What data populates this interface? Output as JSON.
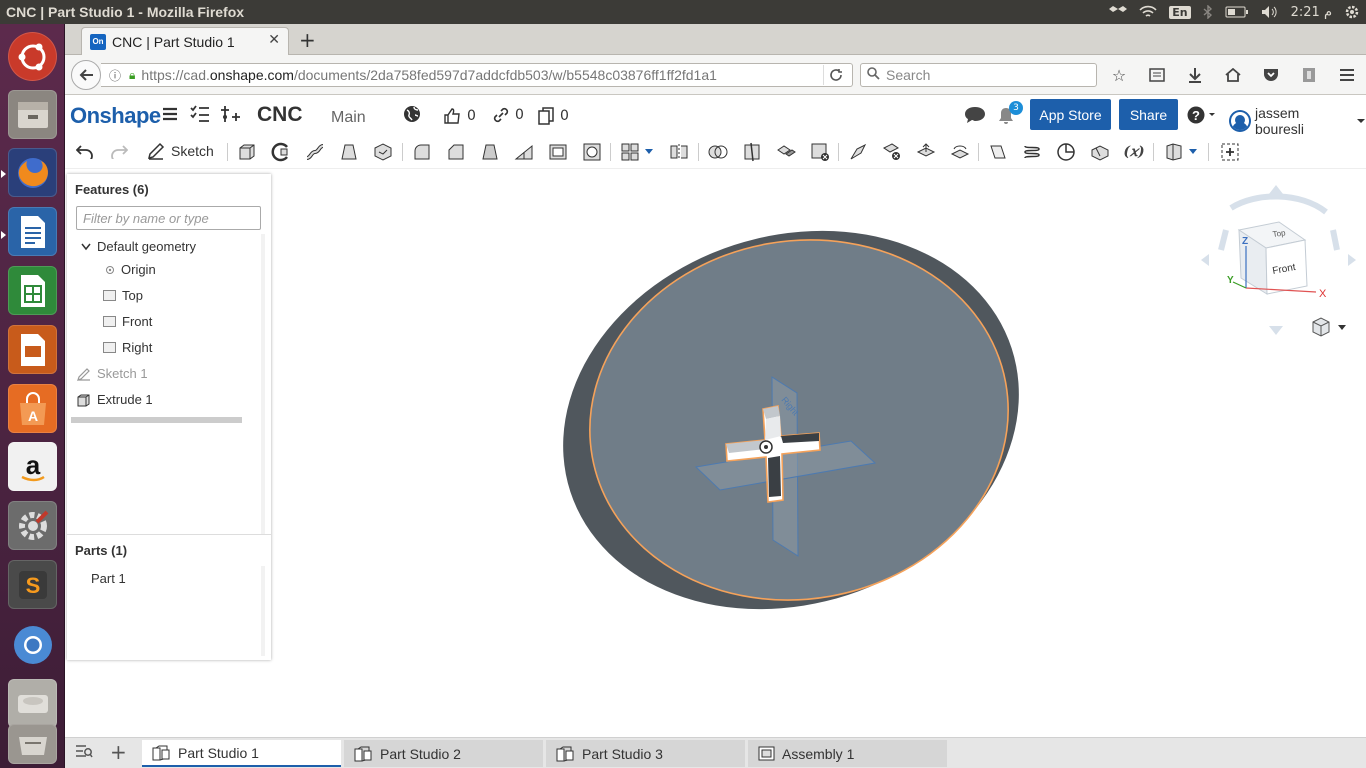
{
  "os_bar": {
    "window_title": "CNC | Part Studio 1 - Mozilla Firefox",
    "keyboard": "En",
    "clock": "م 2:21"
  },
  "launcher": {
    "items": [
      "ubuntu-dash",
      "files",
      "firefox",
      "writer",
      "calc",
      "impress",
      "software-center",
      "amazon",
      "system-settings",
      "sublime-text",
      "chromium",
      "disk",
      "trash"
    ]
  },
  "browser": {
    "tab_title": "CNC | Part Studio 1",
    "tab_favicon": "On",
    "url_prefix": "https://cad.",
    "url_domain": "onshape.com",
    "url_rest": "/documents/2da758fed597d7addcfdb503/w/b5548c03876ff1ff2fd1a1",
    "search_placeholder": "Search"
  },
  "header": {
    "logo": "Onshape",
    "doc_name": "CNC",
    "workspace": "Main",
    "likes": "0",
    "links": "0",
    "copies": "0",
    "notifications": "3",
    "app_store": "App Store",
    "share": "Share",
    "user": "jassem bouresli"
  },
  "toolbar": {
    "sketch_label": "Sketch"
  },
  "features": {
    "title": "Features (6)",
    "filter_placeholder": "Filter by name or type",
    "default_geometry": "Default geometry",
    "origin": "Origin",
    "planes": [
      "Top",
      "Front",
      "Right"
    ],
    "sketch": "Sketch 1",
    "extrude": "Extrude 1"
  },
  "parts": {
    "title": "Parts (1)",
    "items": [
      "Part 1"
    ]
  },
  "view_cube": {
    "top": "Top",
    "front": "Front",
    "x": "X",
    "y": "Y",
    "z": "Z"
  },
  "bottom_tabs": [
    "Part Studio 1",
    "Part Studio 2",
    "Part Studio 3",
    "Assembly 1"
  ],
  "colors": {
    "brand": "#1d5fab",
    "part_face": "#707d88",
    "part_edge": "#f5a25a",
    "launcher": "#4a2340"
  }
}
